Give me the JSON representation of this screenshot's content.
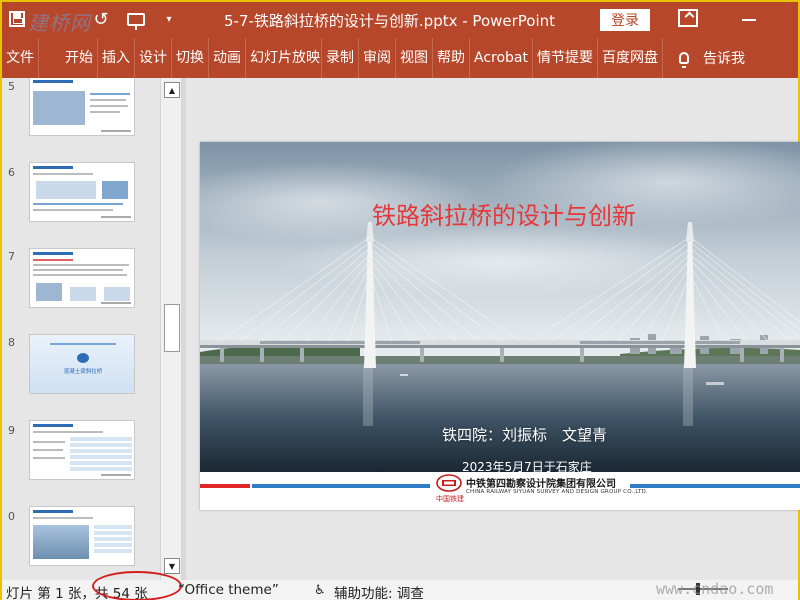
{
  "titlebar": {
    "watermark_logo": "建桥网",
    "doc_title": "5-7-铁路斜拉桥的设计与创新.pptx  -  PowerPoint",
    "login_label": "登录"
  },
  "ribbon": {
    "tabs": [
      "文件",
      "开始",
      "插入",
      "设计",
      "切换",
      "动画",
      "幻灯片放映",
      "录制",
      "审阅",
      "视图",
      "帮助",
      "Acrobat",
      "情节提要",
      "百度网盘"
    ],
    "tell_me": "告诉我"
  },
  "thumbnails": {
    "numbers": [
      "5",
      "6",
      "7",
      "8",
      "9",
      "0"
    ],
    "title_slide_text": "混凝土梁斜拉桥"
  },
  "slide": {
    "title": "铁路斜拉桥的设计与创新",
    "authors": "铁四院：刘振标　文望青",
    "date": "2023年5月7日于石家庄",
    "logo_text": "中国铁建",
    "company_cn": "中铁第四勘察设计院集团有限公司",
    "company_en": "CHINA RAILWAY SIYUAN SURVEY AND DESIGN GROUP CO.,LTD."
  },
  "statusbar": {
    "slide_info": "灯片 第 1 张，共 54 张",
    "theme": "“Office theme”",
    "accessibility": "辅助功能: 调查",
    "watermark": "www.cndao.com"
  },
  "colors": {
    "accent": "#b7472a",
    "title_red": "#e63838",
    "brand_blue": "#2f7cc7",
    "highlight_circle": "#d41e1e"
  }
}
